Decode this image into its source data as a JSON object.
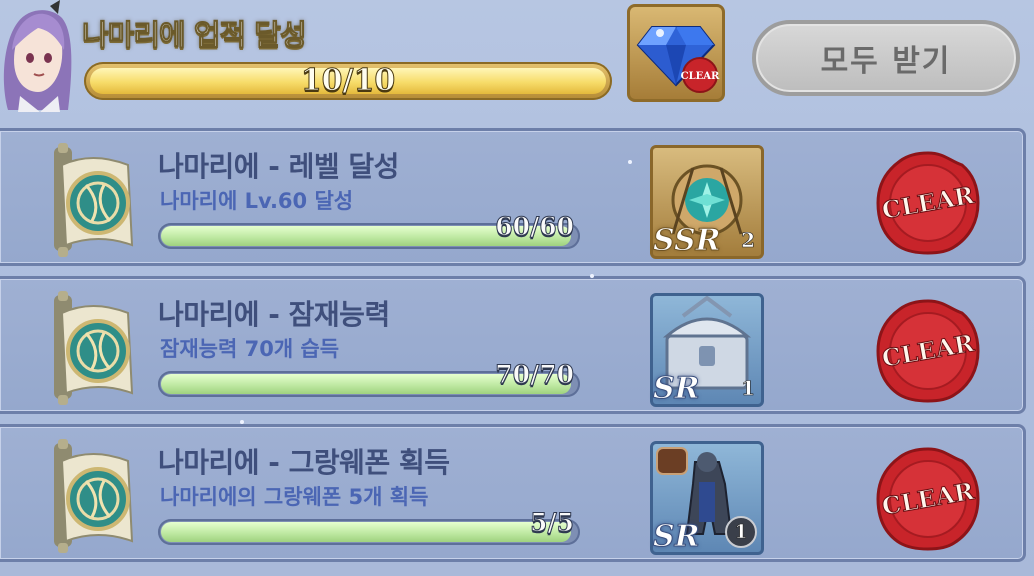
{
  "header": {
    "title": "나마리에 업적 달성",
    "progress_text": "10/10",
    "progress": 1.0,
    "reward": {
      "icon": "blue-diamond-icon",
      "stamp": "CLEAR"
    },
    "claim_all_label": "모두 받기"
  },
  "achievements": [
    {
      "title": "나마리에 - 레벨 달성",
      "description": "나마리에 Lv.60 달성",
      "progress_text": "60/60",
      "progress": 1.0,
      "reward": {
        "icon": "ssr-medallion-icon",
        "rarity": "SSR",
        "count": "2",
        "style": "plain"
      },
      "status": "CLEAR"
    },
    {
      "title": "나마리에 - 잠재능력",
      "description": "잠재능력 70개 습득",
      "progress_text": "70/70",
      "progress": 1.0,
      "reward": {
        "icon": "silver-chest-icon",
        "rarity": "SR",
        "count": "1",
        "style": "plain"
      },
      "status": "CLEAR"
    },
    {
      "title": "나마리에 - 그랑웨폰 획득",
      "description": "나마리에의 그랑웨폰 5개 획득",
      "progress_text": "5/5",
      "progress": 1.0,
      "reward": {
        "icon": "armor-figure-icon",
        "rarity": "SR",
        "count": "1",
        "style": "circle"
      },
      "status": "CLEAR"
    }
  ],
  "colors": {
    "background": "#aebfdf",
    "row_bg": "#9fb0d3",
    "title_text": "#3f4f7c",
    "desc_text": "#4b66b4",
    "bar_fill": "#bfe9a3",
    "header_bar_fill": "#f7dc6a",
    "seal_red": "#c8242a"
  }
}
